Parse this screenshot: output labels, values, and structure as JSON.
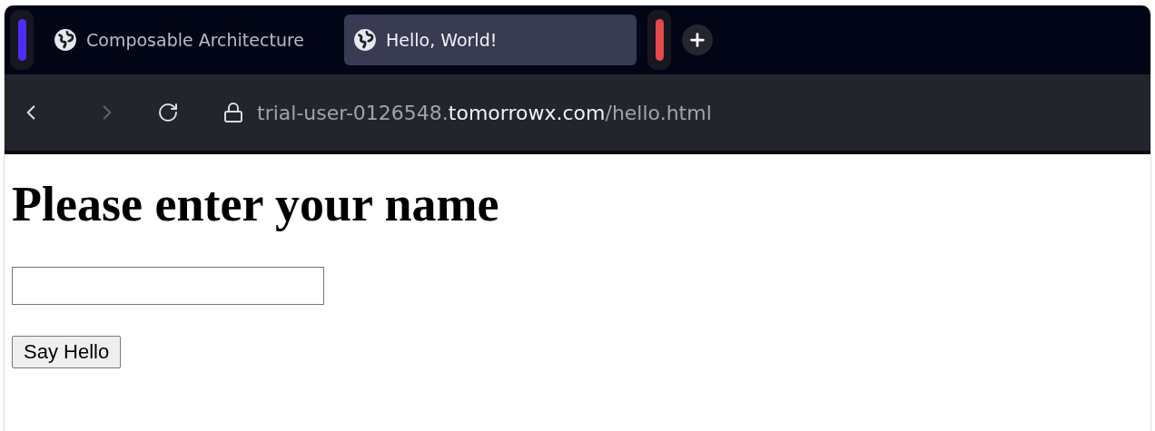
{
  "tab_strip": [
    {
      "kind": "group",
      "color": "#4f2cf5"
    },
    {
      "kind": "tab",
      "label": "Composable Architecture",
      "selected": false
    },
    {
      "kind": "tab",
      "label": "Hello, World!",
      "selected": true
    },
    {
      "kind": "group",
      "color": "#e5484d"
    }
  ],
  "address_bar": {
    "url_prefix": "trial-user-0126548.",
    "url_domain": "tomorrowx.com",
    "url_path": "/hello.html"
  },
  "page": {
    "heading": "Please enter your name",
    "button": "Say Hello"
  }
}
